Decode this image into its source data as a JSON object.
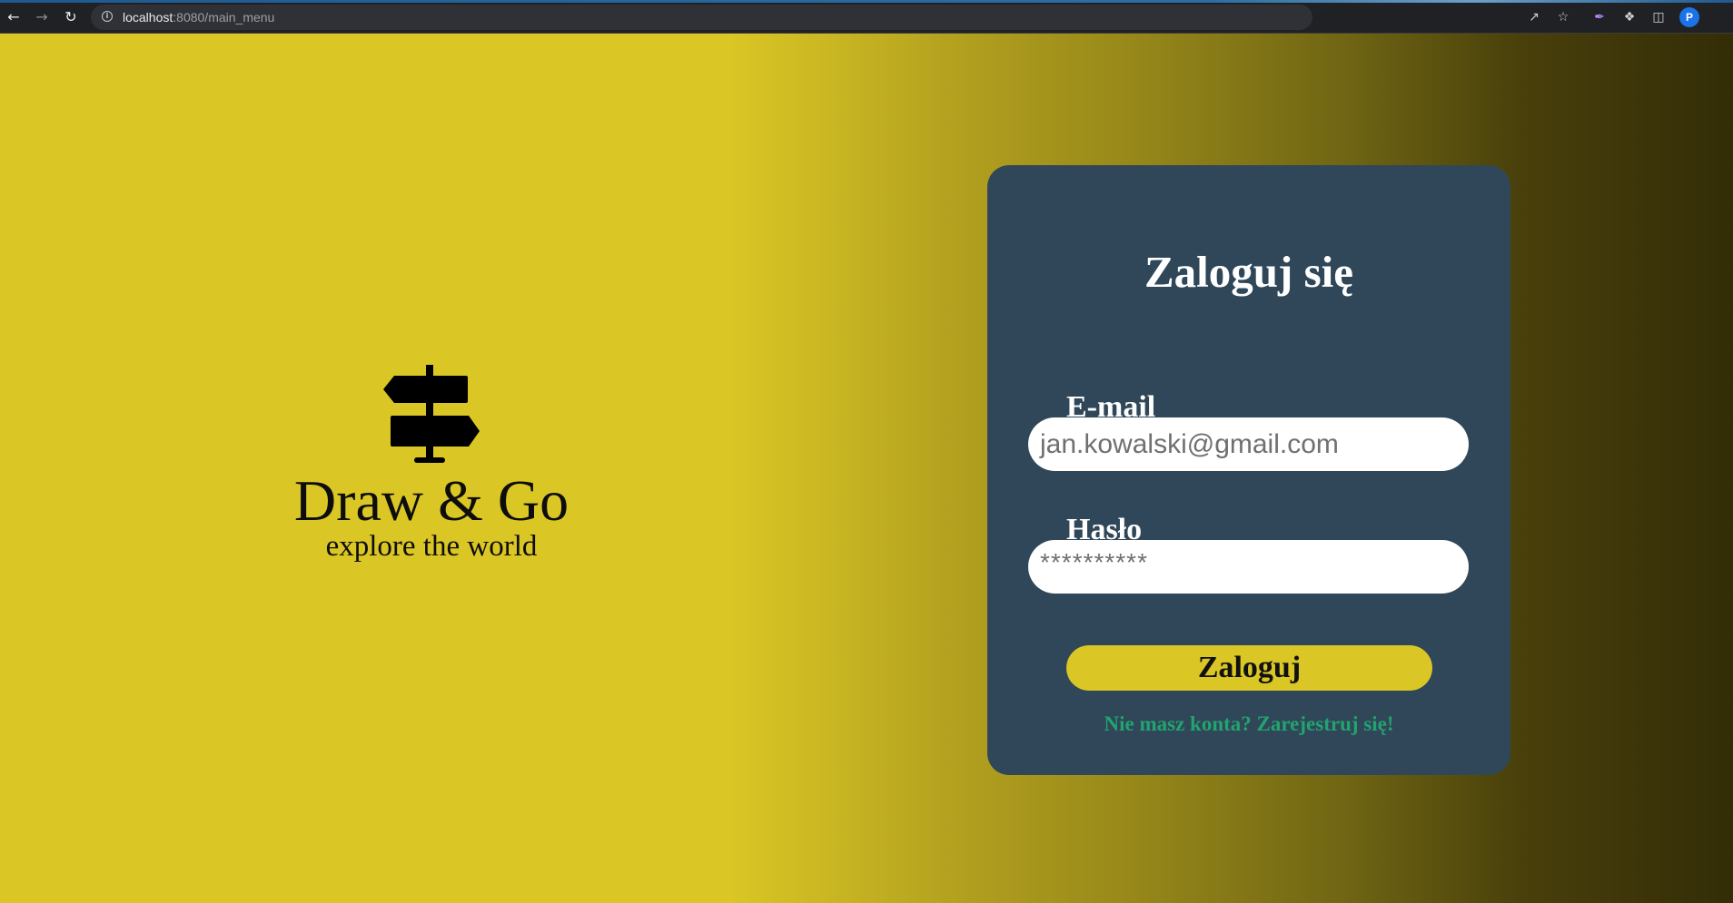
{
  "browser": {
    "url_host": "localhost",
    "url_path": ":8080/main_menu",
    "profile_initial": "P"
  },
  "brand": {
    "icon": "signpost-icon",
    "title": "Draw & Go",
    "tagline": "explore the world"
  },
  "login": {
    "title": "Zaloguj się",
    "email_label": "E-mail",
    "email_value": "jan.kowalski@gmail.com",
    "password_label": "Hasło",
    "password_value": "**********",
    "submit_label": "Zaloguj",
    "register_link": "Nie masz konta? Zarejestruj się!"
  },
  "colors": {
    "accent_yellow": "#dac624",
    "card_background": "#2f4758",
    "link_green": "#22a36f"
  }
}
